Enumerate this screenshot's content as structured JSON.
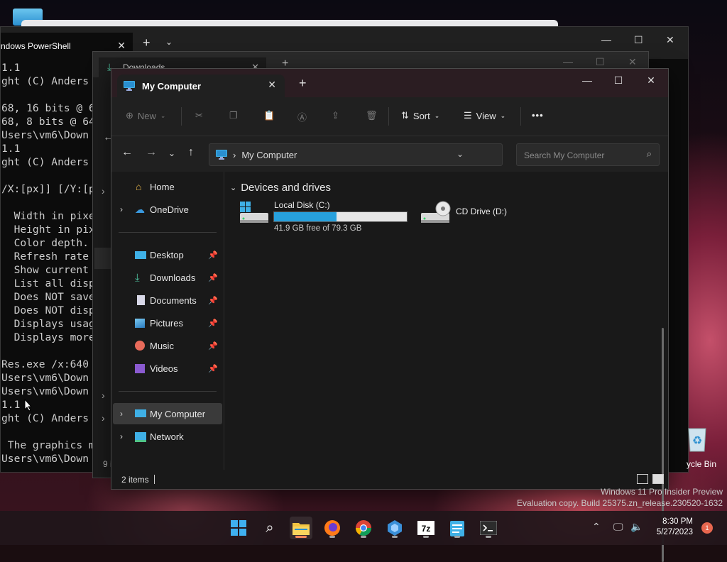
{
  "terminal": {
    "tab_title": "ndows PowerShell",
    "lines": [
      "1.1",
      "ght (C) Anders",
      "",
      "68, 16 bits @ 6",
      "68, 8 bits @ 64",
      "Users\\vm6\\Down",
      "1.1",
      "ght (C) Anders",
      "",
      "/X:[px]] [/Y:[p",
      "",
      "  Width in pixe",
      "  Height in pix",
      "  Color depth.",
      "  Refresh rate",
      "  Show current",
      "  List all disp",
      "  Does NOT save",
      "  Does NOT disp",
      "  Displays usag",
      "  Displays more",
      "",
      "Res.exe /x:640",
      "Users\\vm6\\Down",
      "Users\\vm6\\Down",
      "1.1",
      "ght (C) Anders",
      "",
      " The graphics m",
      "Users\\vm6\\Down"
    ]
  },
  "downloads_window": {
    "tab_title": "Downloads",
    "status_text": "9 i"
  },
  "explorer": {
    "tab_title": "My Computer",
    "toolbar": {
      "new_label": "New",
      "sort_label": "Sort",
      "view_label": "View",
      "more_label": "•••"
    },
    "address": {
      "location": "My Computer"
    },
    "search": {
      "placeholder": "Search My Computer"
    },
    "sidebar": {
      "items": [
        {
          "label": "Home",
          "icon": "home-icon"
        },
        {
          "label": "OneDrive",
          "icon": "cloud-icon"
        },
        {
          "label": "Desktop",
          "icon": "desktop-icon"
        },
        {
          "label": "Downloads",
          "icon": "download-icon"
        },
        {
          "label": "Documents",
          "icon": "document-icon"
        },
        {
          "label": "Pictures",
          "icon": "pictures-icon"
        },
        {
          "label": "Music",
          "icon": "music-icon"
        },
        {
          "label": "Videos",
          "icon": "videos-icon"
        },
        {
          "label": "My Computer",
          "icon": "computer-icon"
        },
        {
          "label": "Network",
          "icon": "network-icon"
        }
      ]
    },
    "section_title": "Devices and drives",
    "drives": [
      {
        "name": "Local Disk (C:)",
        "free_text": "41.9 GB free of 79.3 GB",
        "used_fraction": 0.47
      },
      {
        "name": "CD Drive (D:)"
      }
    ],
    "status": {
      "item_count": "2 items"
    }
  },
  "desktop": {
    "recycle_label": "ycle Bin",
    "watermark_line1": "Windows 11 Pro Insider Preview",
    "watermark_line2": "Evaluation copy. Build 25375.zn_release.230520-1632"
  },
  "taskbar": {
    "time": "8:30 PM",
    "date": "5/27/2023",
    "notification_count": "1",
    "apps": [
      "start-icon",
      "search-icon",
      "file-explorer-icon",
      "firefox-icon",
      "chrome-icon",
      "app-icon",
      "7zip-icon",
      "notepad-icon",
      "terminal-icon"
    ]
  },
  "colors": {
    "accent": "#27a0dc",
    "notification": "#e8674f"
  }
}
